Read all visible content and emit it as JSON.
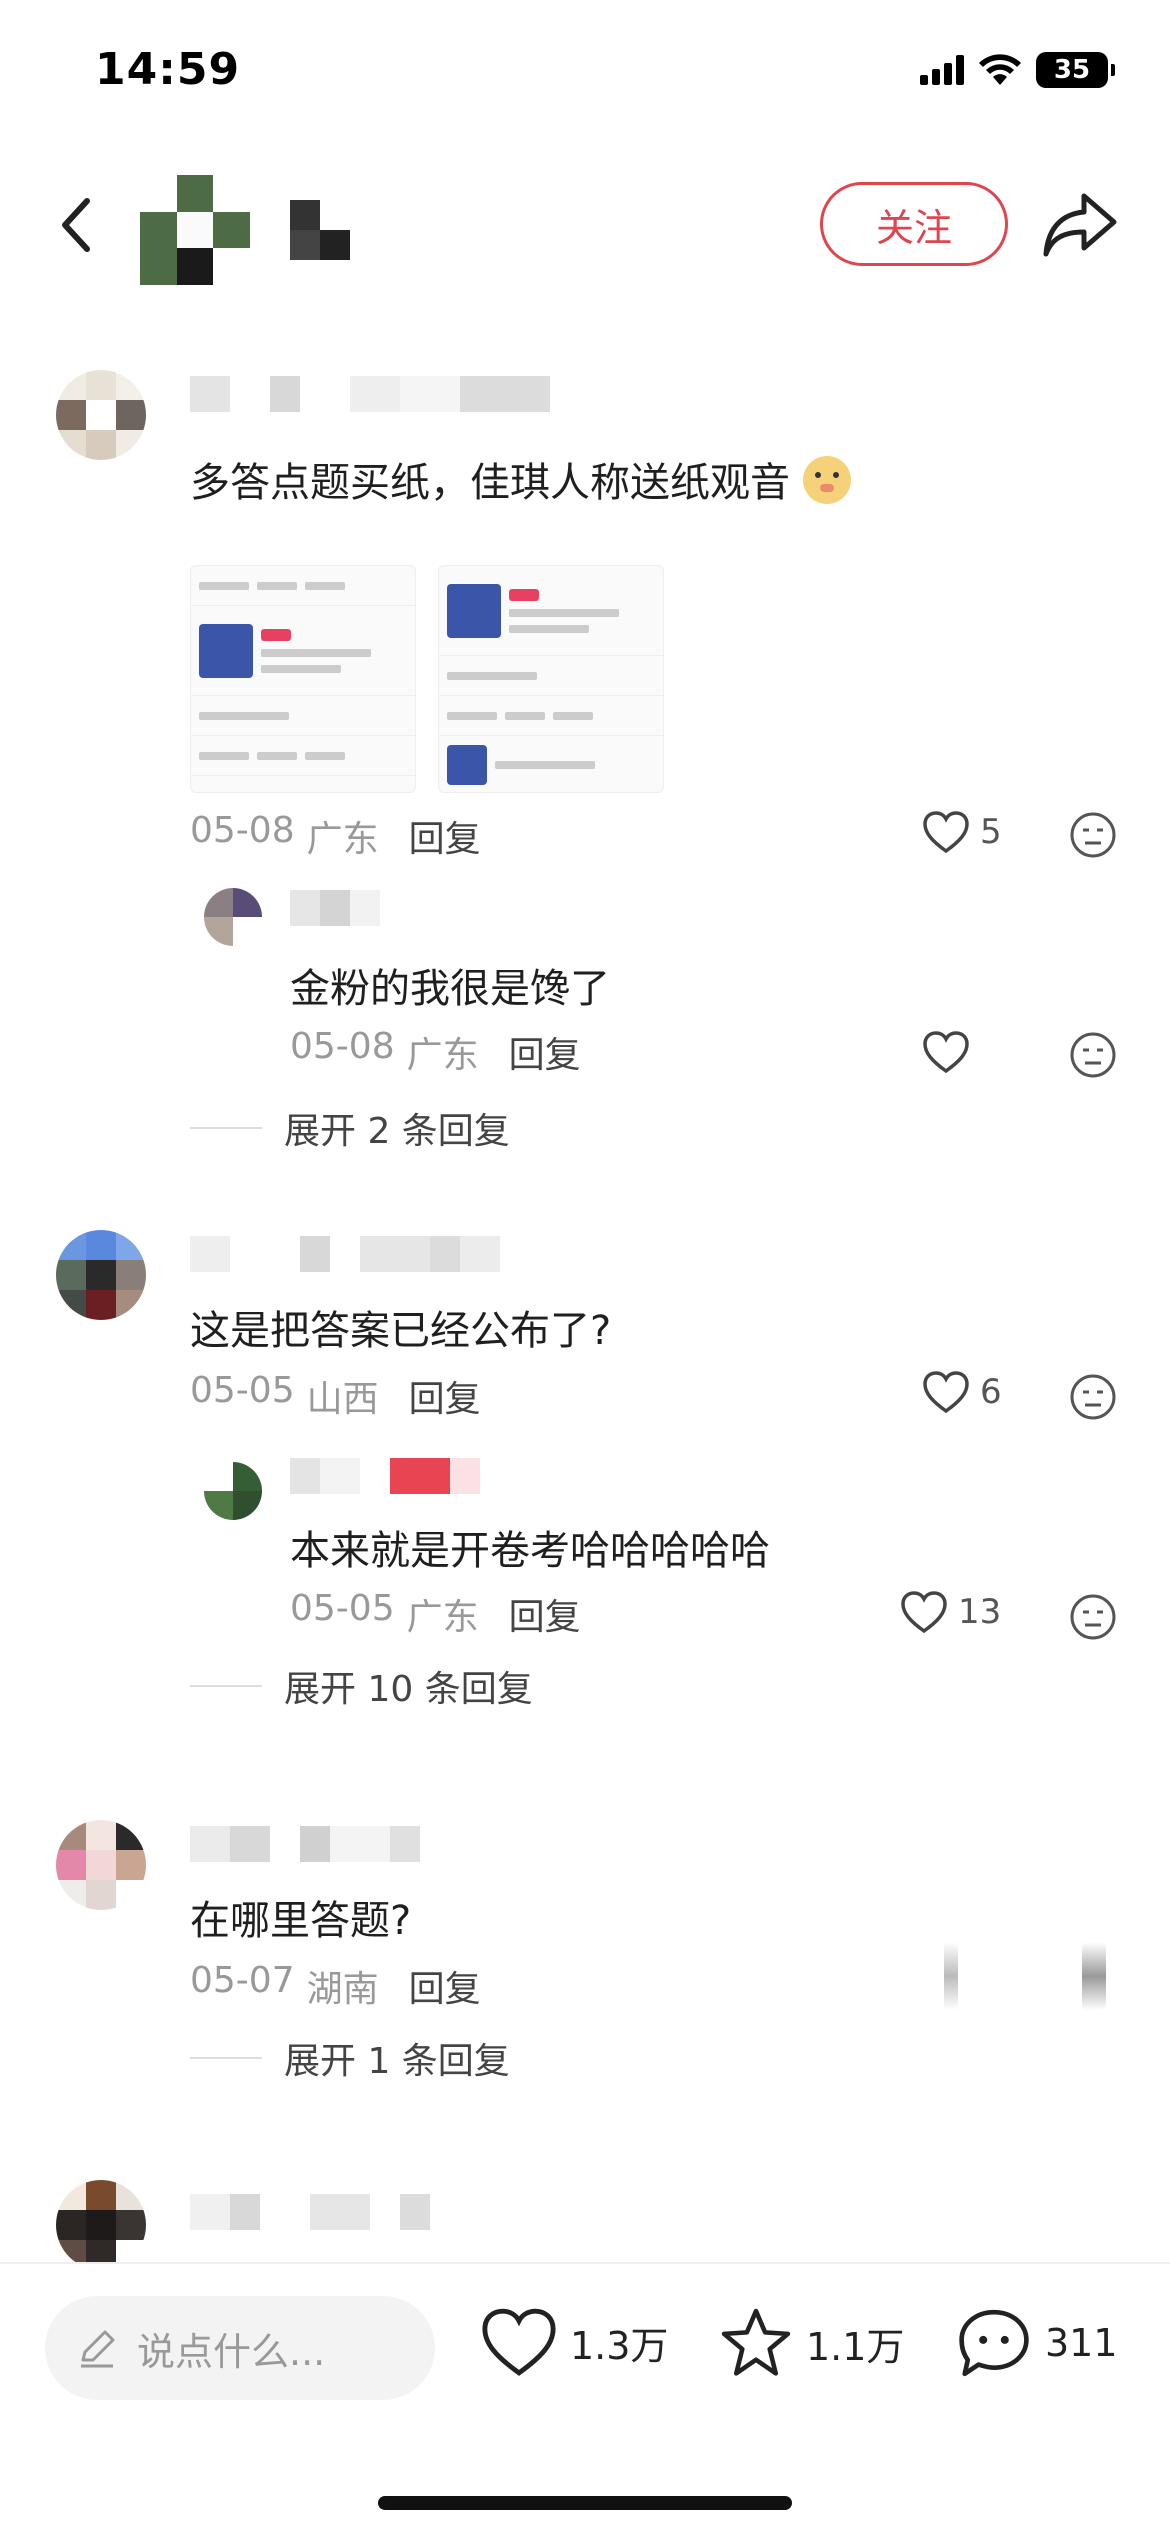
{
  "status_bar": {
    "time": "14:59",
    "battery": "35"
  },
  "header": {
    "follow_label": "关注"
  },
  "comments": [
    {
      "text": "多答点题买纸，佳琪人称送纸观音",
      "emoji": "🐻",
      "date": "05-08",
      "location": "广东",
      "reply_label": "回复",
      "likes": "5",
      "images": [
        "tmall-order-screenshot-1",
        "tmall-order-screenshot-2"
      ],
      "replies": [
        {
          "text": "金粉的我很是馋了",
          "date": "05-08",
          "location": "广东",
          "reply_label": "回复",
          "likes": ""
        }
      ],
      "expand_label": "展开 2 条回复"
    },
    {
      "text": "这是把答案已经公布了?",
      "date": "05-05",
      "location": "山西",
      "reply_label": "回复",
      "likes": "6",
      "replies": [
        {
          "text": "本来就是开卷考哈哈哈哈哈",
          "date": "05-05",
          "location": "广东",
          "reply_label": "回复",
          "likes": "13"
        }
      ],
      "expand_label": "展开 10 条回复"
    },
    {
      "text": "在哪里答题?",
      "date": "05-07",
      "location": "湖南",
      "reply_label": "回复",
      "expand_label": "展开 1 条回复"
    }
  ],
  "bottom_bar": {
    "input_placeholder": "说点什么...",
    "likes": "1.3万",
    "favorites": "1.1万",
    "comments": "311"
  },
  "colors": {
    "accent": "#e0454f",
    "muted": "#999999"
  },
  "icons": [
    "back-icon",
    "share-icon",
    "heart-icon",
    "dislike-face-icon",
    "pen-icon",
    "star-icon",
    "comment-bubble-icon"
  ]
}
